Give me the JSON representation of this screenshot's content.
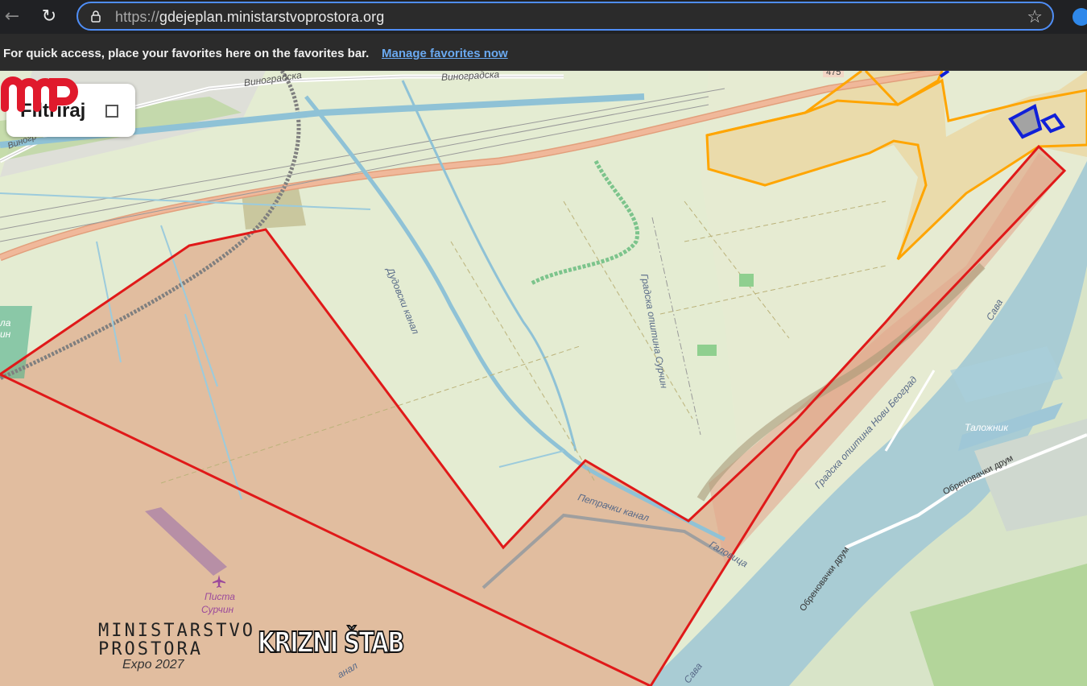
{
  "browser": {
    "url_scheme": "https://",
    "url_host": "gdejeplan.ministarstvoprostora.org",
    "back_icon": "←",
    "reload_icon": "↻",
    "star_icon": "☆"
  },
  "favorites_bar": {
    "message": "For quick access, place your favorites here on the favorites bar.",
    "link_label": "Manage favorites now"
  },
  "map": {
    "filter_label": "Filtriraj",
    "labels": {
      "vinogradska_1": "Виноградска",
      "vinogradska_2": "Виноградска",
      "vinogr_left": "Виногр",
      "badge": "475",
      "dudovski": "Дудовски канал",
      "opstina_surcin": "Градска општина Сурчин",
      "opstina_nbg": "Градска општина Нови Београд",
      "sava_1": "Сава",
      "sava_2": "Сава",
      "petracki": "Петрачки канал",
      "galovica": "Галовица",
      "talozhnik": "Таложник",
      "obrenovacki_1": "Обреновачки друм",
      "obrenovacki_2": "Обреновачки друм",
      "pista": "Писта",
      "surcin": "Сурчин",
      "kanal": "анал",
      "la": "ла",
      "in": "ин"
    },
    "colors": {
      "red_outline": "#e01919",
      "orange_outline": "#ffa500",
      "blue_outline": "#1020d8"
    }
  },
  "branding": {
    "ministry_line1": "MINISTARSTVO",
    "ministry_line2": "PROSTORA",
    "expo": "Expo 2027",
    "krizni": "KRIZNI ŠTAB"
  }
}
